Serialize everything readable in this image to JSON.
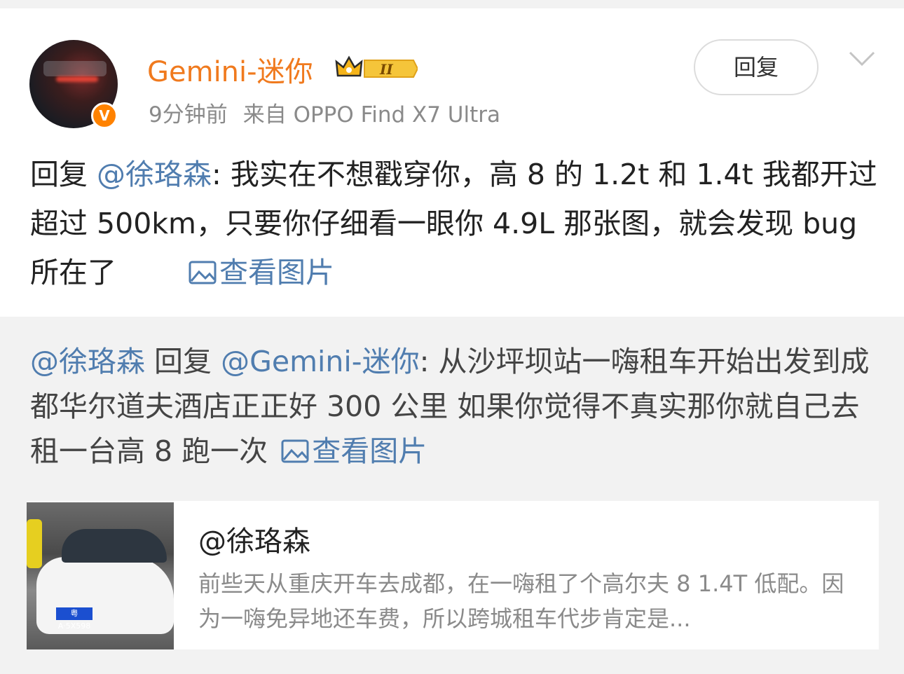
{
  "comment": {
    "username": "Gemini-迷你",
    "verified_badge": "V",
    "time_ago": "9分钟前",
    "source": "来自 OPPO Find X7 Ultra",
    "reply_button_label": "回复",
    "menu_icon": "chevron-down-icon",
    "text_prefix": "回复",
    "mention": "@徐珞森",
    "text_body": ": 我实在不想戳穿你，高 8 的 1.2t 和 1.4t 我都开过超过 500km，只要你仔细看一眼你 4.9L 那张图，就会发现 bug 所在了",
    "view_image_label": "查看图片"
  },
  "quoted": {
    "author_mention": "@徐珞森",
    "reply_word": "回复",
    "target_mention": "@Gemini-迷你",
    "text_body": ": 从沙坪坝站一嗨租车开始出发到成都华尔道夫酒店正正好 300 公里  如果你觉得不真实那你就自己去租一台高 8 跑一次",
    "view_image_label": "查看图片"
  },
  "share_card": {
    "title": "@徐珞森",
    "description": "前些天从重庆开车去成都，在一嗨租了个高尔夫 8 1.4T 低配。因为一嗨免异地还车费，所以跨城租车代步肯定是...",
    "plate_text": "粤A·5X598"
  },
  "colors": {
    "username": "#f07a1e",
    "link": "#507daf",
    "verified": "#ff8200",
    "quote_bg": "#f2f2f2"
  }
}
